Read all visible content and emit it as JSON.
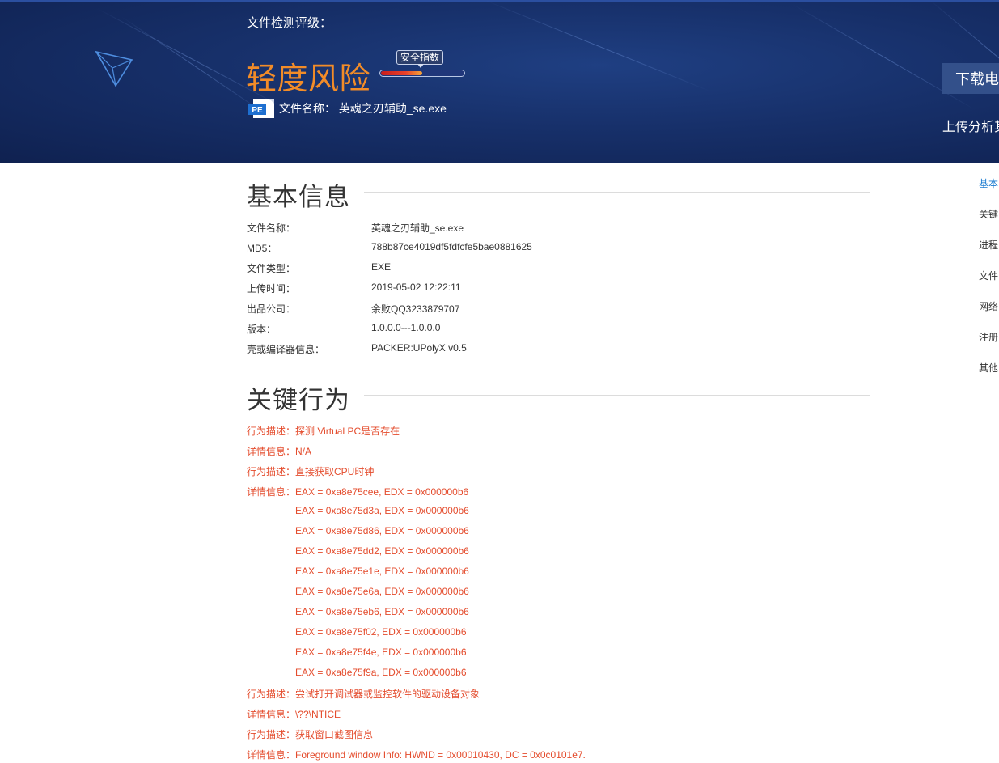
{
  "header": {
    "rating_label": "文件检测评级：",
    "risk_level": "轻度风险",
    "safety_index_label": "安全指数",
    "safety_index_fill": 0.5,
    "file_type_icon": "PE",
    "file_name_label": "文件名称：",
    "file_name": "英魂之刃辅助_se.exe",
    "download_button": "下载电",
    "upload_text": "上传分析其"
  },
  "colors": {
    "banner": "#17306a",
    "risk": "#f28c28",
    "behavior_text": "#e44c2d",
    "nav_active": "#1a7bd0"
  },
  "basic_info": {
    "title": "基本信息",
    "rows": [
      {
        "label": "文件名称：",
        "value": "英魂之刃辅助_se.exe"
      },
      {
        "label": "MD5：",
        "value": "788b87ce4019df5fdfcfe5bae0881625"
      },
      {
        "label": "文件类型：",
        "value": "EXE"
      },
      {
        "label": "上传时间：",
        "value": "2019-05-02 12:22:11"
      },
      {
        "label": "出品公司：",
        "value": "余败QQ3233879707"
      },
      {
        "label": "版本：",
        "value": "1.0.0.0---1.0.0.0"
      },
      {
        "label": "壳或编译器信息：",
        "value": "PACKER:UPolyX v0.5"
      }
    ]
  },
  "key_behavior": {
    "title": "关键行为",
    "desc_label": "行为描述：",
    "detail_label": "详情信息：",
    "items": [
      {
        "desc": "探测 Virtual PC是否存在",
        "details": [
          "N/A"
        ]
      },
      {
        "desc": "直接获取CPU时钟",
        "details": [
          "EAX = 0xa8e75cee, EDX = 0x000000b6",
          "EAX = 0xa8e75d3a, EDX = 0x000000b6",
          "EAX = 0xa8e75d86, EDX = 0x000000b6",
          "EAX = 0xa8e75dd2, EDX = 0x000000b6",
          "EAX = 0xa8e75e1e, EDX = 0x000000b6",
          "EAX = 0xa8e75e6a, EDX = 0x000000b6",
          "EAX = 0xa8e75eb6, EDX = 0x000000b6",
          "EAX = 0xa8e75f02, EDX = 0x000000b6",
          "EAX = 0xa8e75f4e, EDX = 0x000000b6",
          "EAX = 0xa8e75f9a, EDX = 0x000000b6"
        ]
      },
      {
        "desc": "尝试打开调试器或监控软件的驱动设备对象",
        "details": [
          "\\??\\NTICE"
        ]
      },
      {
        "desc": "获取窗口截图信息",
        "details": [
          "Foreground window Info: HWND = 0x00010430, DC = 0x0c0101e7."
        ]
      }
    ]
  },
  "side_nav": {
    "items": [
      {
        "label": "基本",
        "active": true
      },
      {
        "label": "关键",
        "active": false
      },
      {
        "label": "进程",
        "active": false
      },
      {
        "label": "文件",
        "active": false
      },
      {
        "label": "网络",
        "active": false
      },
      {
        "label": "注册",
        "active": false
      },
      {
        "label": "其他",
        "active": false
      }
    ]
  }
}
